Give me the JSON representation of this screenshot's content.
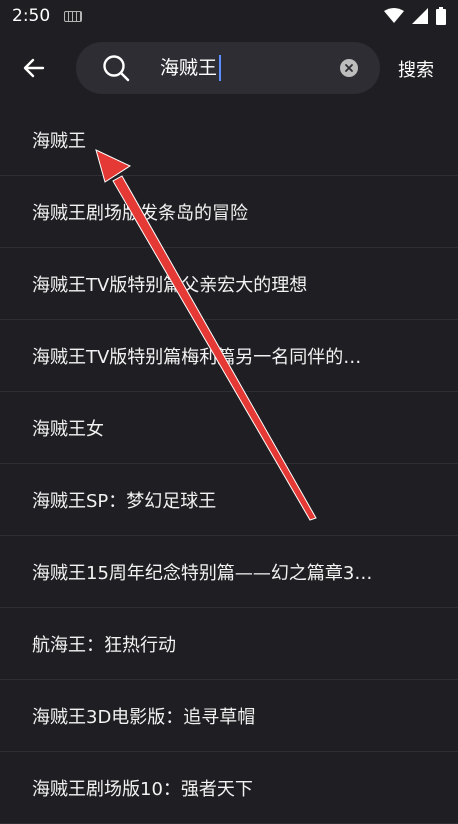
{
  "status_bar": {
    "time": "2:50"
  },
  "search": {
    "query": "海贼王",
    "submit_label": "搜索"
  },
  "results": [
    "海贼王",
    "海贼王剧场版发条岛的冒险",
    "海贼王TV版特别篇父亲宏大的理想",
    "海贼王TV版特别篇梅利篇另一名同伴的…",
    "海贼王女",
    "海贼王SP：梦幻足球王",
    "海贼王15周年纪念特别篇——幻之篇章3…",
    "航海王：狂热行动",
    "海贼王3D电影版：追寻草帽",
    "海贼王剧场版10：强者天下"
  ],
  "colors": {
    "annotation_arrow": "#e53935",
    "caret": "#5b8dff"
  }
}
